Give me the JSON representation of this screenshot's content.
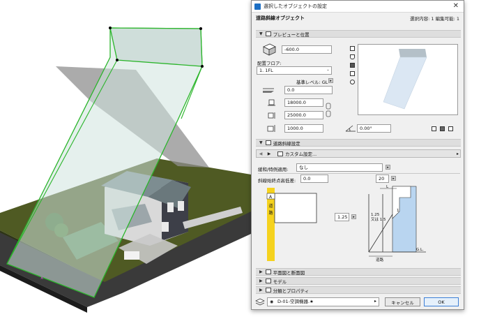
{
  "dialog": {
    "title": "選択したオブジェクトの設定",
    "object_name": "道路斜線オブジェクト",
    "selection_info": "選択内容: 1 編集可能: 1"
  },
  "preview_panel": {
    "header": "プレビューと位置",
    "offset_value": "-600.0",
    "floor_label": "配置フロア:",
    "floor_value": "1. 1FL",
    "base_level_label": "基準レベル: GL",
    "elevation_value": "0.0",
    "width_value": "18000.0",
    "depth_value": "25000.0",
    "height_value": "1000.0",
    "angle_value": "0.00°"
  },
  "road_panel": {
    "header": "道路斜線設定",
    "custom_settings_label": "カスタム設定...",
    "relaxation_label": "緩和/特例適用:",
    "relaxation_value": "なし",
    "start_height_label": "斜線始終点高低差:",
    "start_height_value": "0.0",
    "slope_count_value": "20",
    "slope_ratio_value": "1.25",
    "diagram_road_label_a": "A",
    "diagram_road_label": "道路",
    "diagram_ratio_text": "1.25\n又は 1.5",
    "diagram_l_label": "L",
    "diagram_one_label": "1",
    "diagram_gl_label": "G.L."
  },
  "collapsed_panels": [
    {
      "label": "平面図と断面図"
    },
    {
      "label": "モデル"
    },
    {
      "label": "分類とプロパティ"
    }
  ],
  "footer": {
    "layer_value": "D-01-空調機器.★",
    "cancel_label": "キャンセル",
    "ok_label": "OK"
  },
  "colors": {
    "plane_fill": "#cfe3de",
    "plane_stroke": "#2bb52b",
    "ground": "#4d5a22",
    "road": "#3a3a3a",
    "road_yellow": "#f5d21e",
    "setback_blue": "#b9d5f0"
  }
}
